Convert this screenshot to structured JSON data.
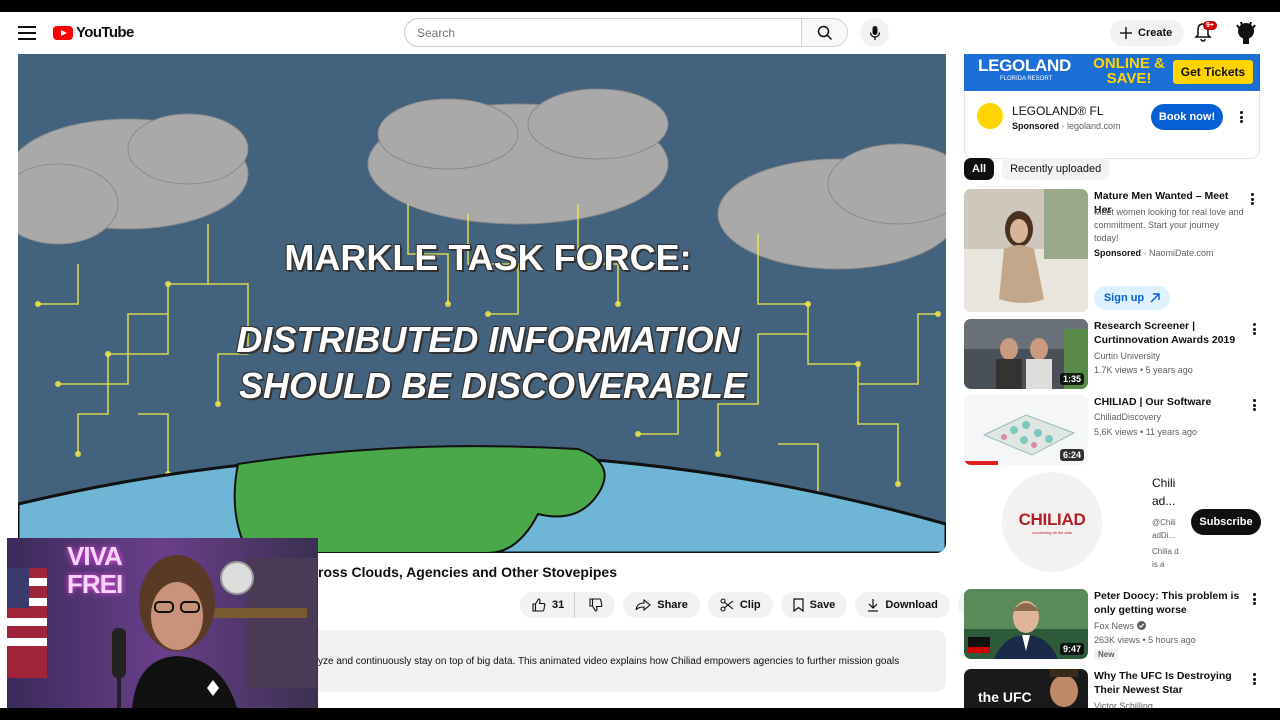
{
  "header": {
    "logo_text": "YouTube",
    "search_placeholder": "Search",
    "create_label": "Create",
    "notification_count": "9+"
  },
  "video": {
    "overlay_line1": "MARKLE TASK FORCE:",
    "overlay_line2": "DISTRIBUTED INFORMATION",
    "overlay_line3": "SHOULD BE DISCOVERABLE",
    "title_visible": "ross Clouds, Agencies and Other Stovepipes",
    "likes": "31",
    "share_label": "Share",
    "clip_label": "Clip",
    "save_label": "Save",
    "download_label": "Download",
    "description_visible": "yze and continuously stay on top of big data. This animated video explains how Chiliad empowers agencies to further mission goals"
  },
  "webcam": {
    "sign_text": "VIVA FREI"
  },
  "ad": {
    "banner_brand": "LEGOLAND",
    "banner_sub": "FLORIDA RESORT",
    "banner_offer": "ONLINE & SAVE!",
    "banner_cta": "Get Tickets",
    "name": "LEGOLAND® FL",
    "sponsored": "Sponsored",
    "domain": "legoland.com",
    "cta": "Book now!"
  },
  "chips": [
    "All",
    "Recently uploaded"
  ],
  "recommendations": [
    {
      "title": "Mature Men Wanted – Meet Her",
      "desc": "Meet women looking for real love and commitment. Start your journey today!",
      "sponsored": "Sponsored",
      "domain": "NaomiDate.com",
      "cta": "Sign up"
    },
    {
      "title": "Research Screener | Curtinnovation Awards 2019",
      "channel": "Curtin University",
      "meta": "1.7K views • 5 years ago",
      "duration": "1:35"
    },
    {
      "title": "CHILIAD | Our Software",
      "channel": "ChiliadDiscovery",
      "meta": "5.6K views • 11 years ago",
      "duration": "6:24"
    },
    {
      "title": "Peter Doocy: This problem is only getting worse",
      "channel": "Fox News",
      "meta": "263K views • 5 hours ago",
      "badge": "New",
      "duration": "9:47"
    },
    {
      "title": "Why The UFC Is Destroying Their Newest Star",
      "channel": "Victor Schilling",
      "thumb_text": "the UFC"
    }
  ],
  "channel_card": {
    "logo": "CHILIAD",
    "tagline": "connecting all the dots",
    "name": "Chili ad...",
    "handle": "@Chili adDi...",
    "desc": "Chilia d is a",
    "subscribe_label": "Subscribe"
  },
  "colors": {
    "youtube_red": "#ff0000",
    "link_blue": "#065fd4",
    "legoland_blue": "#1b6fd6",
    "legoland_yellow": "#ffd400",
    "chiliad_red": "#b2202a"
  }
}
